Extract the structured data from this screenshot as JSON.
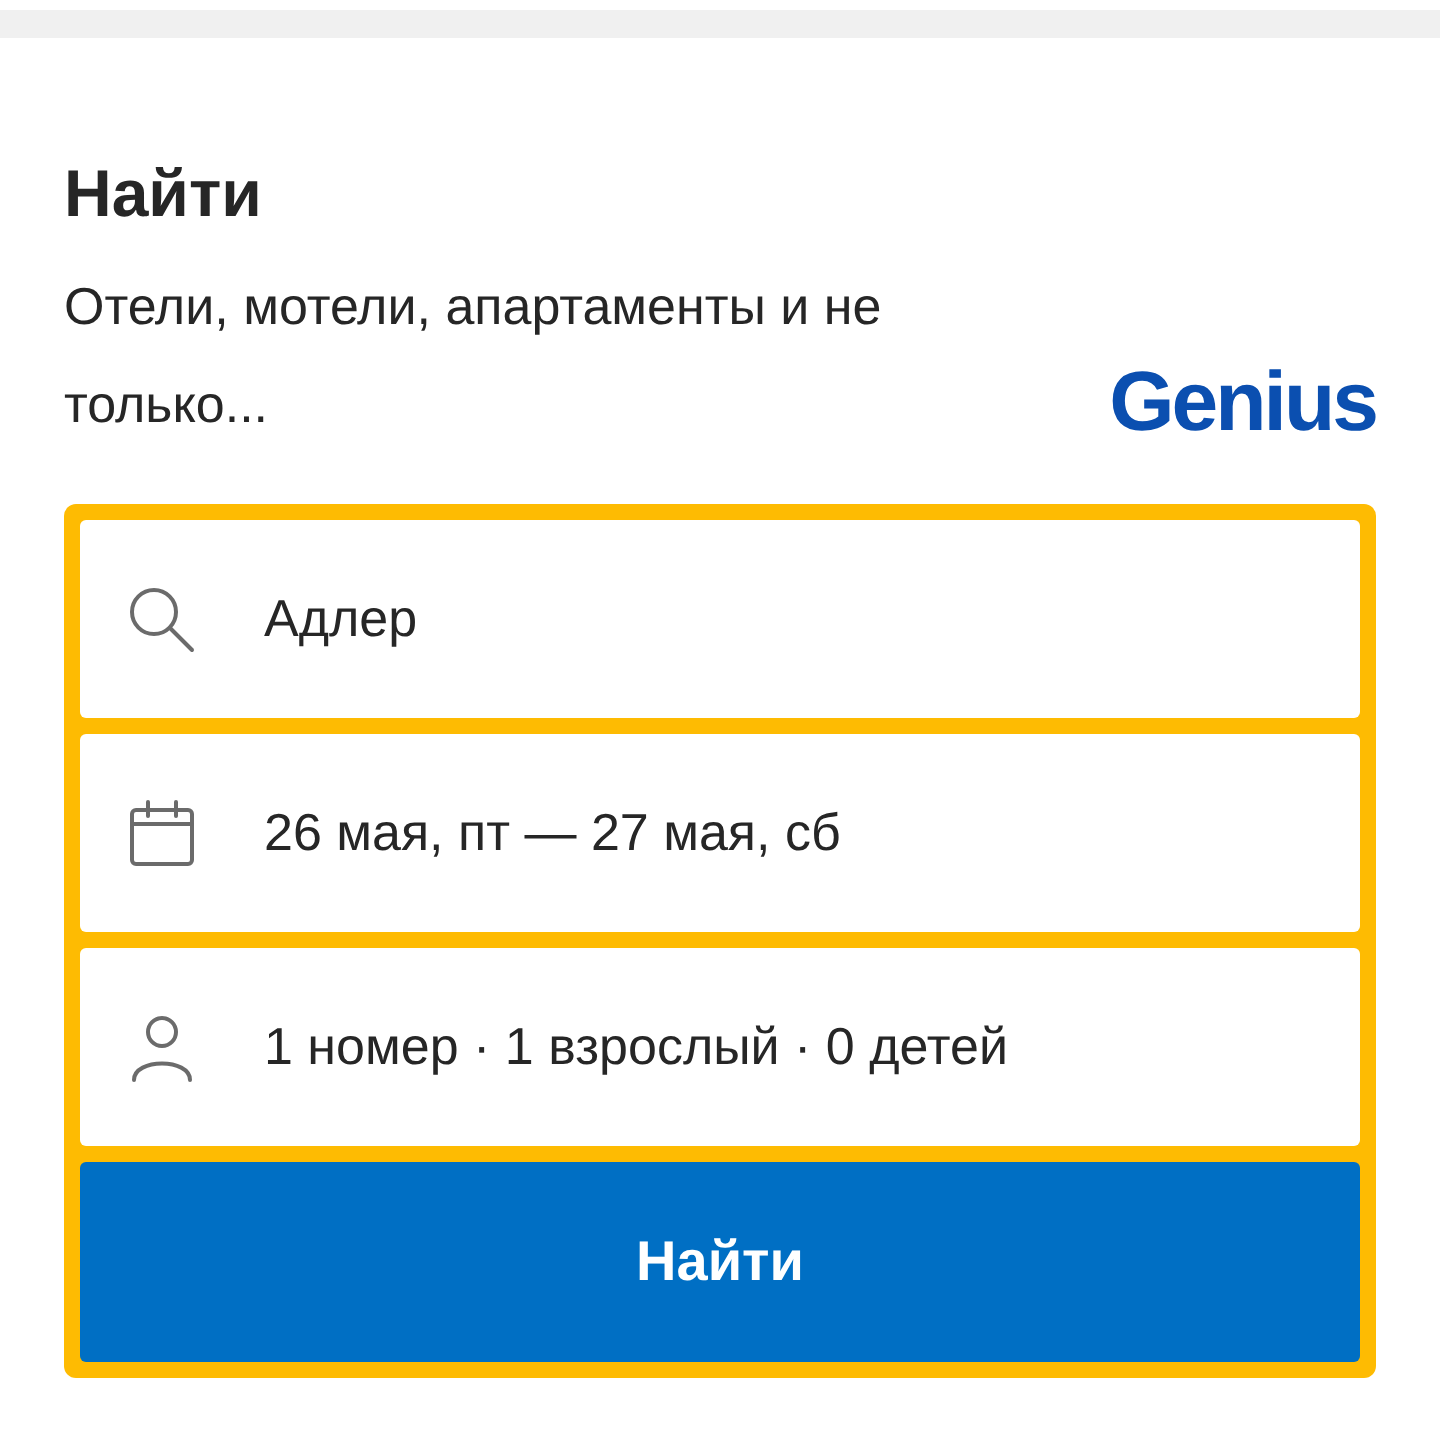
{
  "heading": "Найти",
  "subtitle": "Отели, мотели, апартаменты и не только...",
  "logo": "Genius",
  "fields": [
    {
      "kind": "destination",
      "value": "Адлер"
    },
    {
      "kind": "dates",
      "value": "26 мая, пт — 27 мая, сб"
    },
    {
      "kind": "guests",
      "value": "1 номер · 1 взрослый · 0 детей"
    }
  ],
  "search_button": "Найти"
}
